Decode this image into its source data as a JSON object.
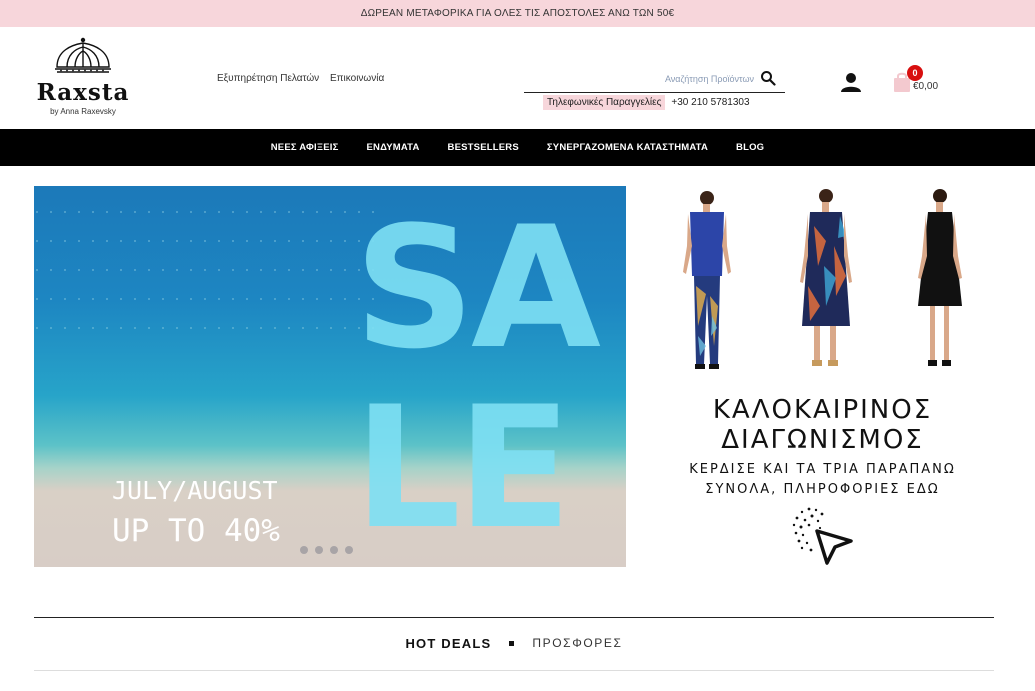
{
  "announcement": "ΔΩΡΕΑΝ ΜΕΤΑΦΟΡΙΚΑ ΓΙΑ ΟΛΕΣ ΤΙΣ ΑΠΟΣΤΟΛΕΣ ΑΝΩ ΤΩΝ 50€",
  "logo": {
    "name": "Raxsta",
    "tagline": "by Anna Raxevsky"
  },
  "top_links": [
    "Εξυπηρέτηση Πελατών",
    "Επικοινωνία"
  ],
  "search": {
    "placeholder": "Αναζήτηση Προϊόντων",
    "icon": "search-icon"
  },
  "phone": {
    "label": "Τηλεφωνικές Παραγγελίες",
    "number": "+30 210 5781303"
  },
  "account": {
    "icon": "user-icon"
  },
  "cart": {
    "icon": "cart-icon",
    "count": "0",
    "total": "€0,00",
    "badge_color": "#d80f0f"
  },
  "nav": [
    "ΝΕΕΣ ΑΦΙΞΕΙΣ",
    "ΕΝΔΥΜΑΤΑ",
    "BESTSELLERS",
    "ΣΥΝΕΡΓΑΖΟΜΕΝΑ ΚΑΤΑΣΤΗΜΑΤΑ",
    "BLOG"
  ],
  "hero": {
    "sale_line1": "SA",
    "sale_line2": "LE",
    "months": "JULY/AUGUST",
    "discount": "UP TO 40%",
    "slide_count": 4
  },
  "promo": {
    "title_line1": "ΚΑΛΟΚΑΙΡΙΝΟΣ",
    "title_line2": "ΔΙΑΓΩΝΙΣΜΟΣ",
    "sub_line1": "ΚΕΡΔΙΣΕ ΚΑΙ ΤΑ ΤΡΙΑ ΠΑΡΑΠΑΝΩ",
    "sub_line2": "ΣΥΝΟΛΑ, ΠΛΗΡΟΦΟΡΙΕΣ ΕΔΩ",
    "cursor_icon": "click-cursor-icon"
  },
  "deals": {
    "hot": "HOT DEALS",
    "offers": "ΠΡΟΣΦΟΡΕΣ"
  },
  "colors": {
    "announcement_bg": "#f7d6db",
    "nav_bg": "#000000",
    "sale_text": "#7ee0f4"
  }
}
